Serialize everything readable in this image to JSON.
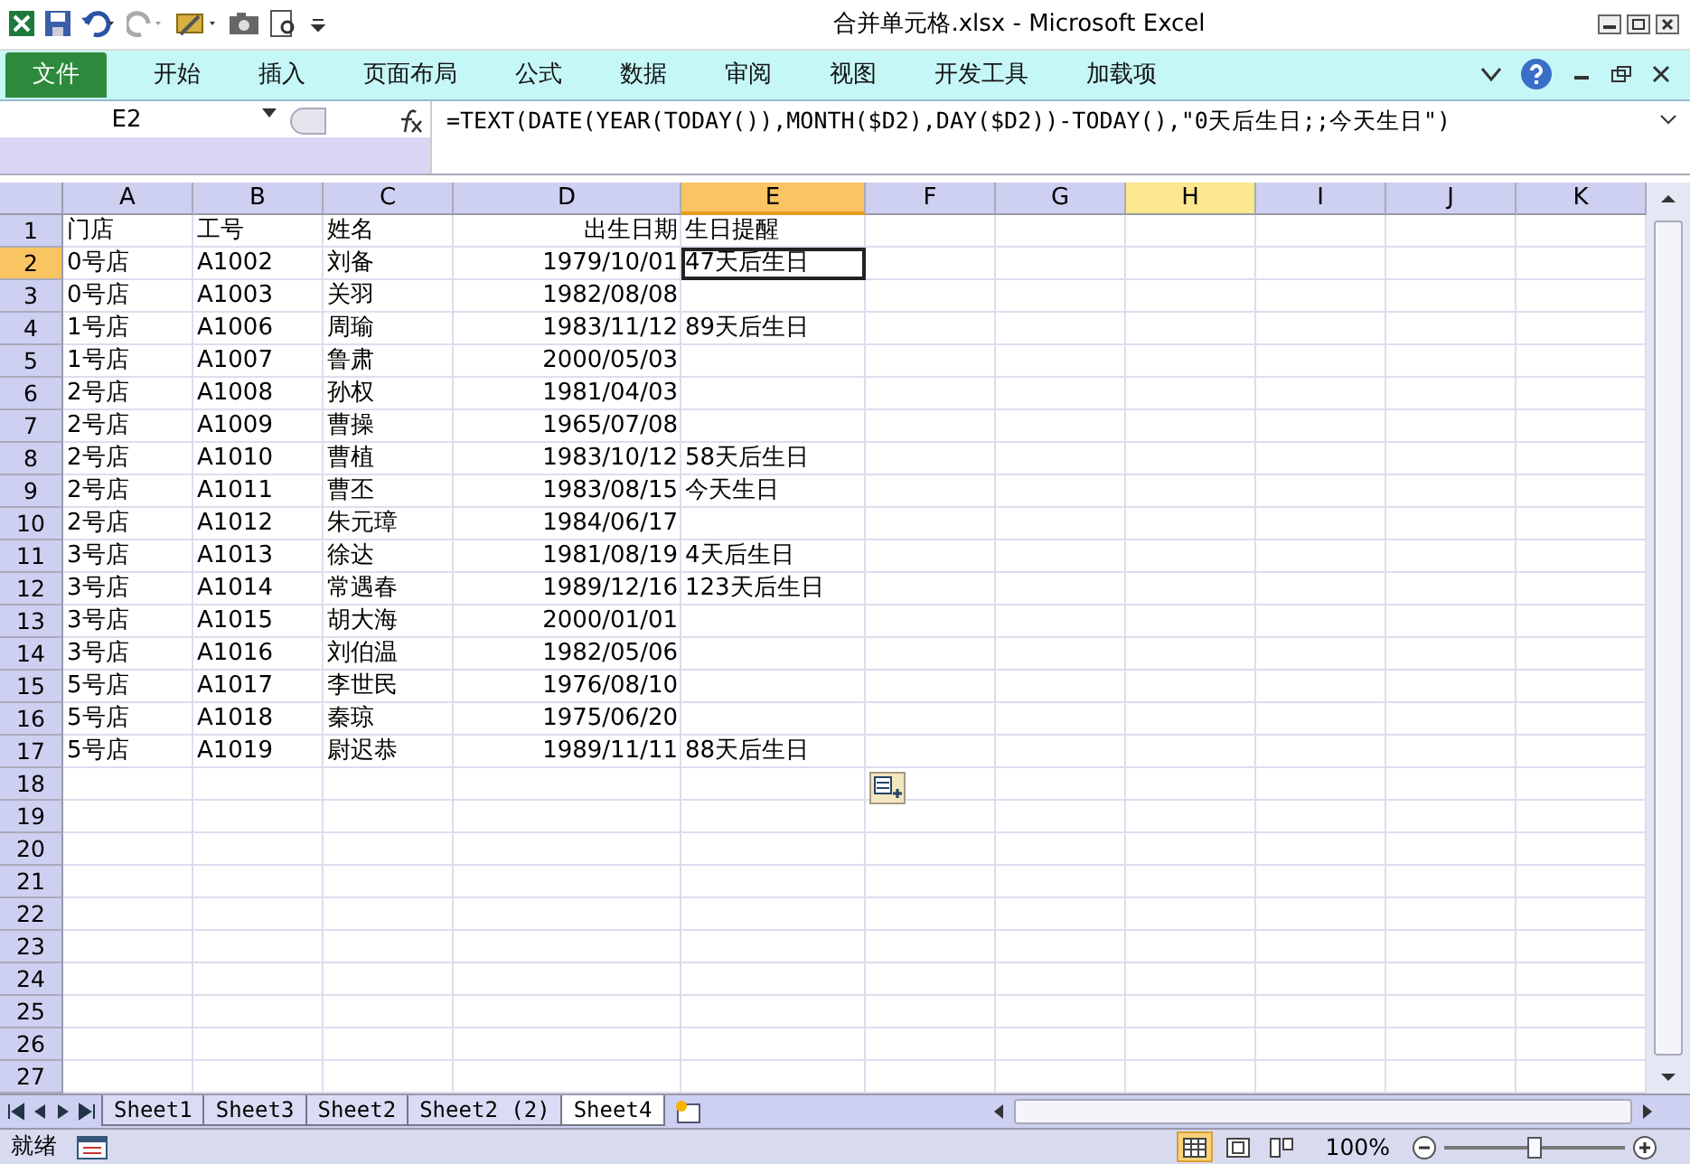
{
  "window": {
    "title": "合并单元格.xlsx  -  Microsoft Excel"
  },
  "ribbon_tabs": [
    {
      "label": "文件",
      "kind": "file",
      "selected": false
    },
    {
      "label": "开始",
      "kind": "tab",
      "selected": false
    },
    {
      "label": "插入",
      "kind": "tab",
      "selected": false
    },
    {
      "label": "页面布局",
      "kind": "tab",
      "selected": false
    },
    {
      "label": "公式",
      "kind": "tab",
      "selected": false
    },
    {
      "label": "数据",
      "kind": "tab",
      "selected": false
    },
    {
      "label": "审阅",
      "kind": "tab",
      "selected": false
    },
    {
      "label": "视图",
      "kind": "tab",
      "selected": false
    },
    {
      "label": "开发工具",
      "kind": "tab",
      "selected": false
    },
    {
      "label": "加载项",
      "kind": "tab",
      "selected": false
    }
  ],
  "formula_bar": {
    "name_box": "E2",
    "formula": "=TEXT(DATE(YEAR(TODAY()),MONTH($D2),DAY($D2))-TODAY(),\"0天后生日;;今天生日\")"
  },
  "columns": [
    {
      "label": "A",
      "kind": "text",
      "selected": false,
      "hovered": false
    },
    {
      "label": "B",
      "kind": "text",
      "selected": false,
      "hovered": false
    },
    {
      "label": "C",
      "kind": "text",
      "selected": false,
      "hovered": false
    },
    {
      "label": "D",
      "kind": "number",
      "selected": false,
      "hovered": false
    },
    {
      "label": "E",
      "kind": "text",
      "selected": true,
      "hovered": false
    },
    {
      "label": "F",
      "kind": "text",
      "selected": false,
      "hovered": false
    },
    {
      "label": "G",
      "kind": "text",
      "selected": false,
      "hovered": false
    },
    {
      "label": "H",
      "kind": "text",
      "selected": false,
      "hovered": true
    },
    {
      "label": "I",
      "kind": "text",
      "selected": false,
      "hovered": false
    },
    {
      "label": "J",
      "kind": "text",
      "selected": false,
      "hovered": false
    },
    {
      "label": "K",
      "kind": "text",
      "selected": false,
      "hovered": false
    }
  ],
  "rows": [
    {
      "label": "1",
      "selected": false,
      "cells": [
        "门店",
        "工号",
        "姓名",
        "出生日期",
        "生日提醒"
      ]
    },
    {
      "label": "2",
      "selected": true,
      "cells": [
        "0号店",
        "A1002",
        "刘备",
        "1979/10/01",
        "47天后生日"
      ]
    },
    {
      "label": "3",
      "selected": false,
      "cells": [
        "0号店",
        "A1003",
        "关羽",
        "1982/08/08"
      ]
    },
    {
      "label": "4",
      "selected": false,
      "cells": [
        "1号店",
        "A1006",
        "周瑜",
        "1983/11/12",
        "89天后生日"
      ]
    },
    {
      "label": "5",
      "selected": false,
      "cells": [
        "1号店",
        "A1007",
        "鲁肃",
        "2000/05/03"
      ]
    },
    {
      "label": "6",
      "selected": false,
      "cells": [
        "2号店",
        "A1008",
        "孙权",
        "1981/04/03"
      ]
    },
    {
      "label": "7",
      "selected": false,
      "cells": [
        "2号店",
        "A1009",
        "曹操",
        "1965/07/08"
      ]
    },
    {
      "label": "8",
      "selected": false,
      "cells": [
        "2号店",
        "A1010",
        "曹植",
        "1983/10/12",
        "58天后生日"
      ]
    },
    {
      "label": "9",
      "selected": false,
      "cells": [
        "2号店",
        "A1011",
        "曹丕",
        "1983/08/15",
        "今天生日"
      ]
    },
    {
      "label": "10",
      "selected": false,
      "cells": [
        "2号店",
        "A1012",
        "朱元璋",
        "1984/06/17"
      ]
    },
    {
      "label": "11",
      "selected": false,
      "cells": [
        "3号店",
        "A1013",
        "徐达",
        "1981/08/19",
        "4天后生日"
      ]
    },
    {
      "label": "12",
      "selected": false,
      "cells": [
        "3号店",
        "A1014",
        "常遇春",
        "1989/12/16",
        "123天后生日"
      ]
    },
    {
      "label": "13",
      "selected": false,
      "cells": [
        "3号店",
        "A1015",
        "胡大海",
        "2000/01/01"
      ]
    },
    {
      "label": "14",
      "selected": false,
      "cells": [
        "3号店",
        "A1016",
        "刘伯温",
        "1982/05/06"
      ]
    },
    {
      "label": "15",
      "selected": false,
      "cells": [
        "5号店",
        "A1017",
        "李世民",
        "1976/08/10"
      ]
    },
    {
      "label": "16",
      "selected": false,
      "cells": [
        "5号店",
        "A1018",
        "秦琼",
        "1975/06/20"
      ]
    },
    {
      "label": "17",
      "selected": false,
      "cells": [
        "5号店",
        "A1019",
        "尉迟恭",
        "1989/11/11",
        "88天后生日"
      ]
    },
    {
      "label": "18",
      "selected": false
    },
    {
      "label": "19",
      "selected": false
    },
    {
      "label": "20",
      "selected": false
    },
    {
      "label": "21",
      "selected": false
    },
    {
      "label": "22",
      "selected": false
    },
    {
      "label": "23",
      "selected": false
    },
    {
      "label": "24",
      "selected": false
    },
    {
      "label": "25",
      "selected": false
    },
    {
      "label": "26",
      "selected": false
    },
    {
      "label": "27",
      "selected": false
    }
  ],
  "sheet_tabs": [
    {
      "label": "Sheet1",
      "selected": false
    },
    {
      "label": "Sheet3",
      "selected": false
    },
    {
      "label": "Sheet2",
      "selected": false
    },
    {
      "label": "Sheet2 (2)",
      "selected": false
    },
    {
      "label": "Sheet4",
      "selected": true
    }
  ],
  "status_bar": {
    "status": "就绪",
    "views": [
      {
        "kind": "normal",
        "selected": true
      },
      {
        "kind": "layout",
        "selected": false
      },
      {
        "kind": "break",
        "selected": false
      }
    ],
    "zoom": "100%",
    "zoom_slider": {
      "level": 0.5
    }
  }
}
